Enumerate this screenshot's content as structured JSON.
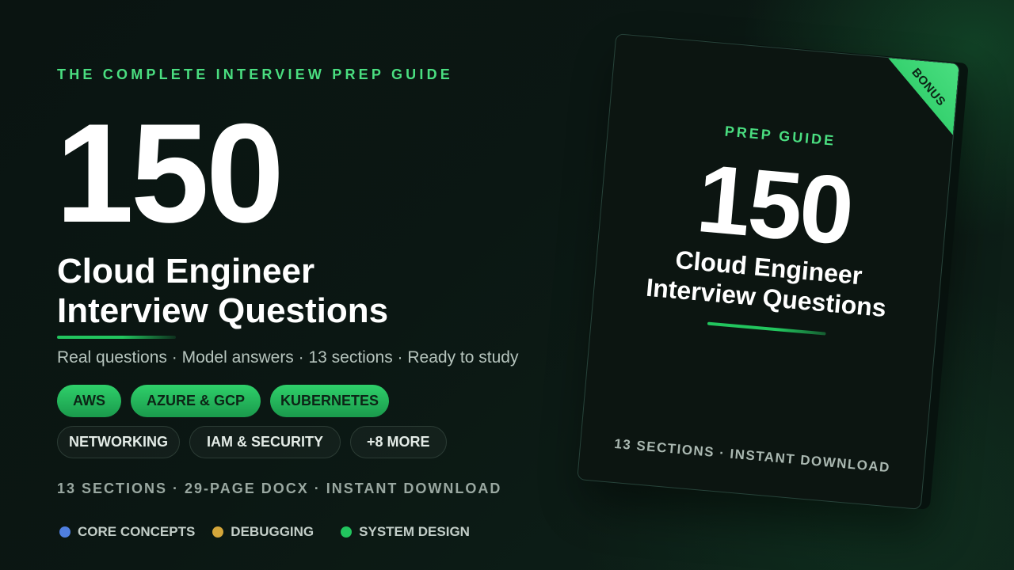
{
  "hero": {
    "eyebrow": "THE COMPLETE INTERVIEW PREP GUIDE",
    "number": "150",
    "title_line1": "Cloud Engineer",
    "title_line2": "Interview Questions",
    "subtitle": "Real questions · Model answers · 13 sections · Ready to study"
  },
  "chips": {
    "primary": [
      "AWS",
      "AZURE & GCP",
      "KUBERNETES"
    ],
    "secondary": [
      "NETWORKING",
      "IAM & SECURITY",
      "+8 MORE"
    ]
  },
  "meta_line": "13 SECTIONS · 29-PAGE DOCX · INSTANT DOWNLOAD",
  "legend": [
    {
      "label": "CORE CONCEPTS",
      "color": "#4f7fe0"
    },
    {
      "label": "DEBUGGING",
      "color": "#d4a63a"
    },
    {
      "label": "SYSTEM DESIGN",
      "color": "#22c55e"
    }
  ],
  "book": {
    "ribbon": "BONUS",
    "eyebrow": "PREP GUIDE",
    "number": "150",
    "title_line1": "Cloud Engineer",
    "title_line2": "Interview Questions",
    "footer": "13 SECTIONS · INSTANT DOWNLOAD"
  },
  "colors": {
    "accent": "#22c55e",
    "accent_light": "#4ade80",
    "background": "#0b1713"
  }
}
